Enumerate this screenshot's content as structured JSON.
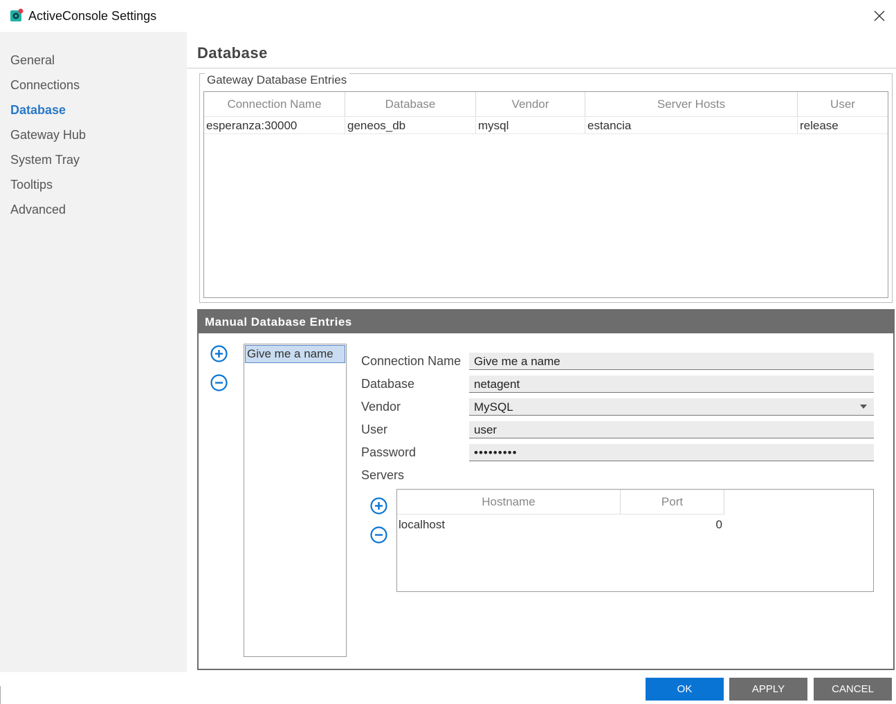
{
  "window": {
    "title": "ActiveConsole Settings"
  },
  "sidebar": {
    "items": [
      {
        "label": "General"
      },
      {
        "label": "Connections"
      },
      {
        "label": "Database"
      },
      {
        "label": "Gateway Hub"
      },
      {
        "label": "System Tray"
      },
      {
        "label": "Tooltips"
      },
      {
        "label": "Advanced"
      }
    ],
    "active_index": 2
  },
  "page": {
    "title": "Database"
  },
  "gateway_entries": {
    "legend": "Gateway Database Entries",
    "columns": [
      "Connection Name",
      "Database",
      "Vendor",
      "Server Hosts",
      "User"
    ],
    "rows": [
      [
        "esperanza:30000",
        "geneos_db",
        "mysql",
        "estancia",
        "release"
      ]
    ]
  },
  "manual_entries": {
    "header": "Manual Database Entries",
    "list": [
      "Give me a name"
    ],
    "form": {
      "connection_name_label": "Connection Name",
      "connection_name_value": "Give me a name",
      "database_label": "Database",
      "database_value": "netagent",
      "vendor_label": "Vendor",
      "vendor_value": "MySQL",
      "user_label": "User",
      "user_value": "user",
      "password_label": "Password",
      "password_value": "•••••••••",
      "servers_label": "Servers"
    },
    "servers": {
      "columns": [
        "Hostname",
        "Port"
      ],
      "rows": [
        [
          "localhost",
          "0"
        ]
      ]
    }
  },
  "footer": {
    "ok_label": "OK",
    "apply_label": "APPLY",
    "cancel_label": "CANCEL"
  },
  "colors": {
    "accent": "#0a74d4",
    "active_nav": "#2a78c8",
    "header_gray": "#6d6d6d",
    "icon_teal": "#1fb3a8",
    "icon_red": "#e23a4f"
  },
  "icons": {
    "app": "activeconsole-app-icon",
    "close": "close-icon",
    "add": "plus-circle-icon",
    "remove": "minus-circle-icon",
    "dropdown": "chevron-down-icon"
  }
}
